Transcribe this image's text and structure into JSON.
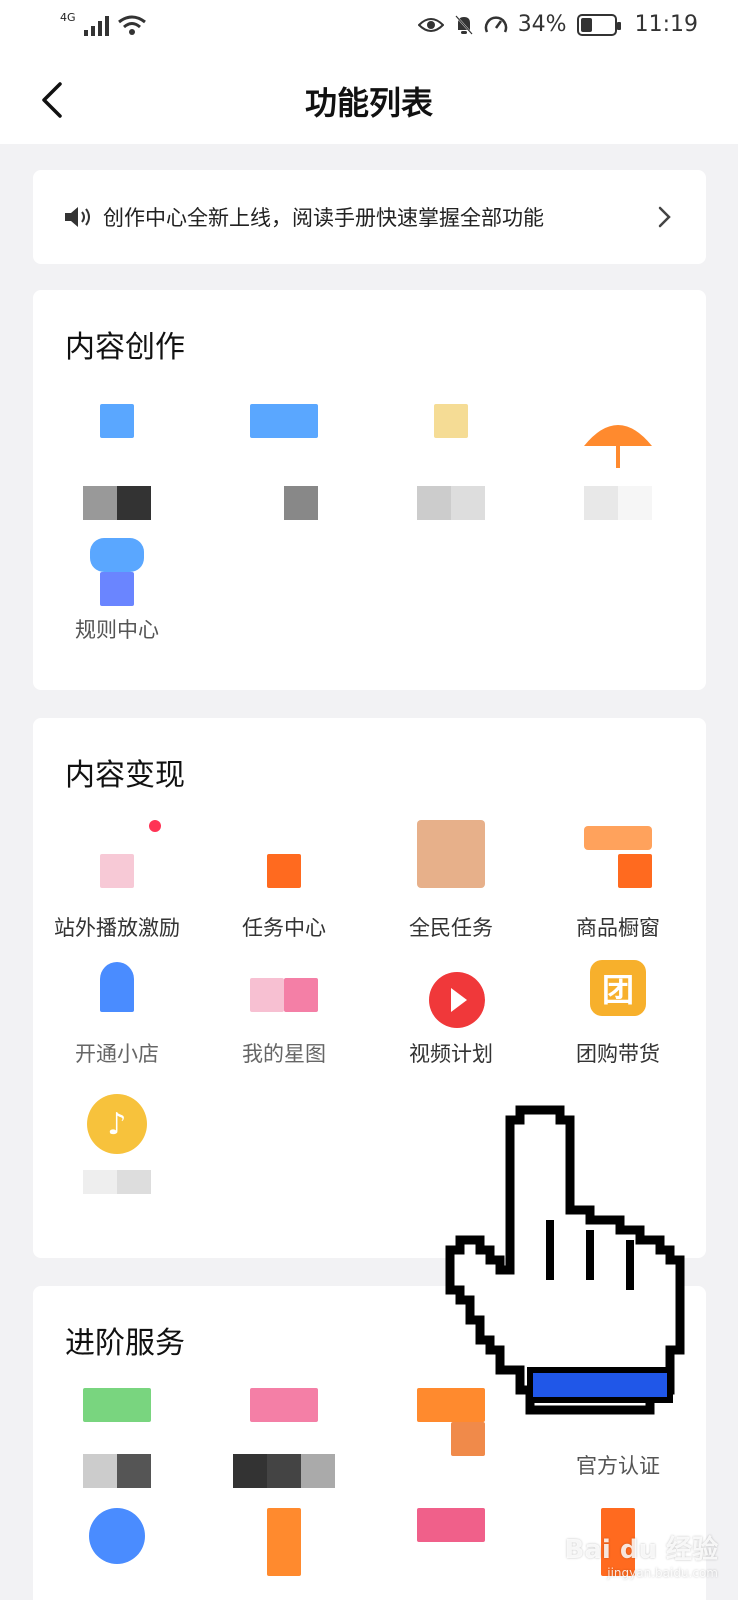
{
  "status_bar": {
    "network": "4G",
    "battery_percent_text": "34%",
    "battery_level": 0.34,
    "time": "11:19"
  },
  "header": {
    "title": "功能列表"
  },
  "notice": {
    "text": "创作中心全新上线，阅读手册快速掌握全部功能"
  },
  "sections": {
    "content_creation": {
      "title": "内容创作",
      "items": [
        {
          "label": "",
          "color": "#5aa7ff"
        },
        {
          "label": "",
          "color": "#5aa7ff"
        },
        {
          "label": "",
          "color": "#f5dc95"
        },
        {
          "label": "",
          "color": "#ff8a2e"
        },
        {
          "label": "规则中心",
          "color": "#4a8cff"
        }
      ]
    },
    "monetization": {
      "title": "内容变现",
      "items": [
        {
          "label": "站外播放激励",
          "color": "#f7c9d6"
        },
        {
          "label": "任务中心",
          "color": "#ff6a1f"
        },
        {
          "label": "全民任务",
          "color": "#e7b08a"
        },
        {
          "label": "商品橱窗",
          "color": "#ff6a1f"
        },
        {
          "label": "开通小店",
          "color": "#4a8cff"
        },
        {
          "label": "我的星图",
          "color": "#f47fa6"
        },
        {
          "label": "视频计划",
          "color": "#f0383a"
        },
        {
          "label": "团购带货",
          "color": "#f7b02c"
        },
        {
          "label": "",
          "color": "#f7c23c"
        }
      ]
    },
    "advanced": {
      "title": "进阶服务",
      "items": [
        {
          "label": "成长中心",
          "color": "#79d57f"
        },
        {
          "label": "",
          "color": "#f47fa6"
        },
        {
          "label": "",
          "color": "#ff8a2e"
        },
        {
          "label": "官方认证",
          "color": "#ffffff"
        },
        {
          "label": "",
          "color": "#4a8cff"
        },
        {
          "label": "",
          "color": "#ff8a2e"
        },
        {
          "label": "",
          "color": "#f0608a"
        },
        {
          "label": "",
          "color": "#ff6a1f"
        }
      ]
    }
  },
  "watermark": {
    "brand": "Bai du 经验",
    "url": "jingyan.baidu.com"
  }
}
